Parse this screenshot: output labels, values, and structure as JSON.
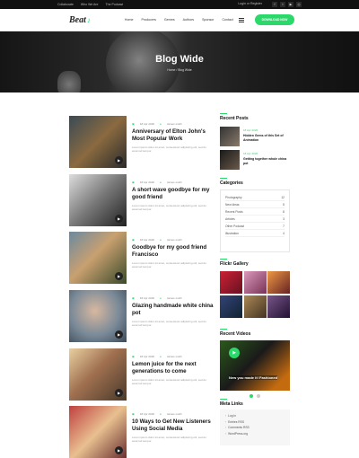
{
  "topbar": {
    "links": [
      "Collaborate",
      "Who We Are",
      "The Podcast"
    ],
    "login": "Login or Register",
    "social_icons": [
      "facebook-icon",
      "twitter-icon",
      "youtube-icon",
      "instagram-icon"
    ]
  },
  "header": {
    "logo": "Beat",
    "menu": [
      "Home",
      "Producers",
      "Genres",
      "Authors",
      "Sponsor",
      "Contact"
    ],
    "download_label": "DOWNLOAD NOW"
  },
  "hero": {
    "title": "Blog Wide",
    "breadcrumb": "Home / Blog Wide"
  },
  "posts": [
    {
      "date": "18 Apr 2020",
      "author": "James smith",
      "title": "Anniversary of Elton John's Most Popular Work",
      "excerpt": "Lorem ipsum dolor sit amet, consectetur adipiscing elit, sed do eiusmod tempor."
    },
    {
      "date": "18 Apr 2020",
      "author": "James smith",
      "title": "A short wave goodbye for my good friend",
      "excerpt": "Lorem ipsum dolor sit amet, consectetur adipiscing elit, sed do eiusmod tempor."
    },
    {
      "date": "18 Apr 2020",
      "author": "James smith",
      "title": "Goodbye for my good friend Francisco",
      "excerpt": "Lorem ipsum dolor sit amet, consectetur adipiscing elit, sed do eiusmod tempor."
    },
    {
      "date": "18 Apr 2020",
      "author": "James smith",
      "title": "Glazing handmade white china pot",
      "excerpt": "Lorem ipsum dolor sit amet, consectetur adipiscing elit, sed do eiusmod tempor."
    },
    {
      "date": "18 Apr 2020",
      "author": "James smith",
      "title": "Lemon juice for the next generations to come",
      "excerpt": "Lorem ipsum dolor sit amet, consectetur adipiscing elit, sed do eiusmod tempor."
    },
    {
      "date": "18 Apr 2020",
      "author": "James smith",
      "title": "10 Ways to Get New Listeners Using Social Media",
      "excerpt": "Lorem ipsum dolor sit amet, consectetur adipiscing elit, sed do eiusmod tempor."
    }
  ],
  "sidebar": {
    "recent_title": "Recent Posts",
    "recent": [
      {
        "date": "18 Apr 2020",
        "title": "Hidden Gems of this Set of Animation"
      },
      {
        "date": "18 Apr 2020",
        "title": "Getting together whole china pot"
      }
    ],
    "categories_title": "Categories",
    "categories": [
      {
        "name": "Photography",
        "count": "12"
      },
      {
        "name": "New Ideas",
        "count": "5"
      },
      {
        "name": "Recent Posts",
        "count": "8"
      },
      {
        "name": "Articles",
        "count": "3"
      },
      {
        "name": "Other Podcast",
        "count": "7"
      },
      {
        "name": "Illustration",
        "count": "4"
      }
    ],
    "gallery_title": "Flickr Gallery",
    "videos_title": "Recent Videos",
    "video_caption": "New you made it! Fashioned",
    "links_title": "Meta Links",
    "links": [
      "Log in",
      "Entries RSS",
      "Comments RSS",
      "WordPress.org"
    ]
  },
  "colors": {
    "accent": "#2bd96b",
    "dark": "#111111"
  }
}
